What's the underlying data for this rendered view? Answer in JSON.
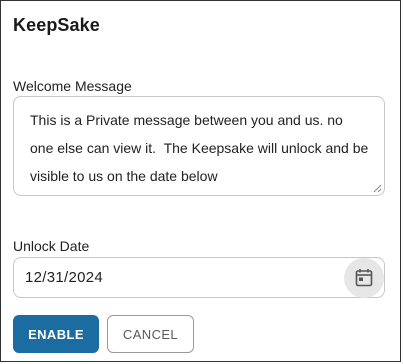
{
  "dialog": {
    "title": "KeepSake"
  },
  "welcome": {
    "label": "Welcome Message",
    "value": "This is a Private message between you and us. no one else can view it.  The Keepsake will unlock and be visible to us on the date below"
  },
  "unlock": {
    "label": "Unlock Date",
    "value": "12/31/2024",
    "icon": "calendar-icon"
  },
  "actions": {
    "enable_label": "ENABLE",
    "cancel_label": "CANCEL"
  },
  "colors": {
    "primary": "#1b6ca0",
    "border": "#c7c7c7"
  }
}
